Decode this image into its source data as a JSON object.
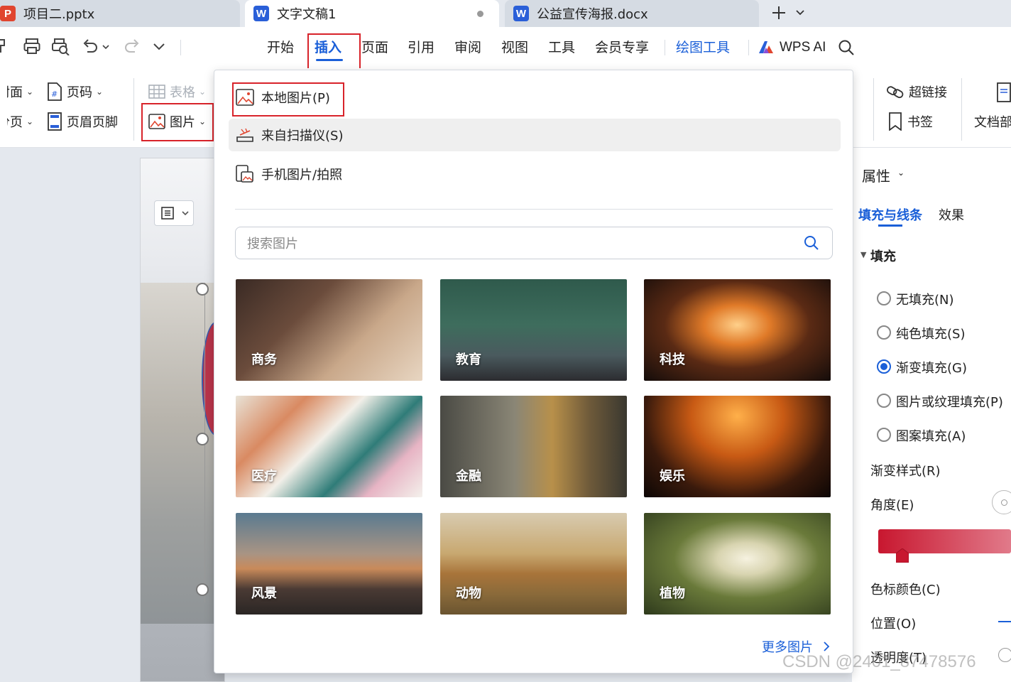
{
  "tabs": [
    {
      "label": "项目二.pptx",
      "logo": "P",
      "color": "#e0452f"
    },
    {
      "label": "文字文稿1",
      "logo": "W",
      "color": "#2a5fd8"
    },
    {
      "label": "公益宣传海报.docx",
      "logo": "W",
      "color": "#2a5fd8"
    }
  ],
  "menu": {
    "items": [
      "开始",
      "插入",
      "页面",
      "引用",
      "审阅",
      "视图",
      "工具",
      "会员专享",
      "绘图工具"
    ],
    "wps_ai": "WPS AI"
  },
  "ribbon": {
    "cover": "封面",
    "pagebreak": "分页",
    "pagenum": "页码",
    "headerfooter": "页眉页脚",
    "table": "表格",
    "picture": "图片",
    "hyperlink": "超链接",
    "bookmark": "书签",
    "docpart": "文档部"
  },
  "dropdown": {
    "local": "本地图片(P)",
    "scanner": "来自扫描仪(S)",
    "phone": "手机图片/拍照",
    "search_placeholder": "搜索图片",
    "categories": [
      "商务",
      "教育",
      "科技",
      "医疗",
      "金融",
      "娱乐",
      "风景",
      "动物",
      "植物"
    ],
    "more": "更多图片"
  },
  "pane": {
    "title": "属性",
    "tab_fill": "填充与线条",
    "tab_effect": "效果",
    "section": "填充",
    "options": [
      "无填充(N)",
      "纯色填充(S)",
      "渐变填充(G)",
      "图片或纹理填充(P)",
      "图案填充(A)"
    ],
    "selected": "渐变填充(G)",
    "gradient_style": "渐变样式(R)",
    "angle": "角度(E)",
    "stop_color": "色标颜色(C)",
    "position": "位置(O)",
    "transparency": "透明度(T)"
  },
  "watermark": "CSDN @2401_87478576",
  "colors": {
    "accent": "#1a5fd8",
    "highlight": "#d8232a"
  }
}
